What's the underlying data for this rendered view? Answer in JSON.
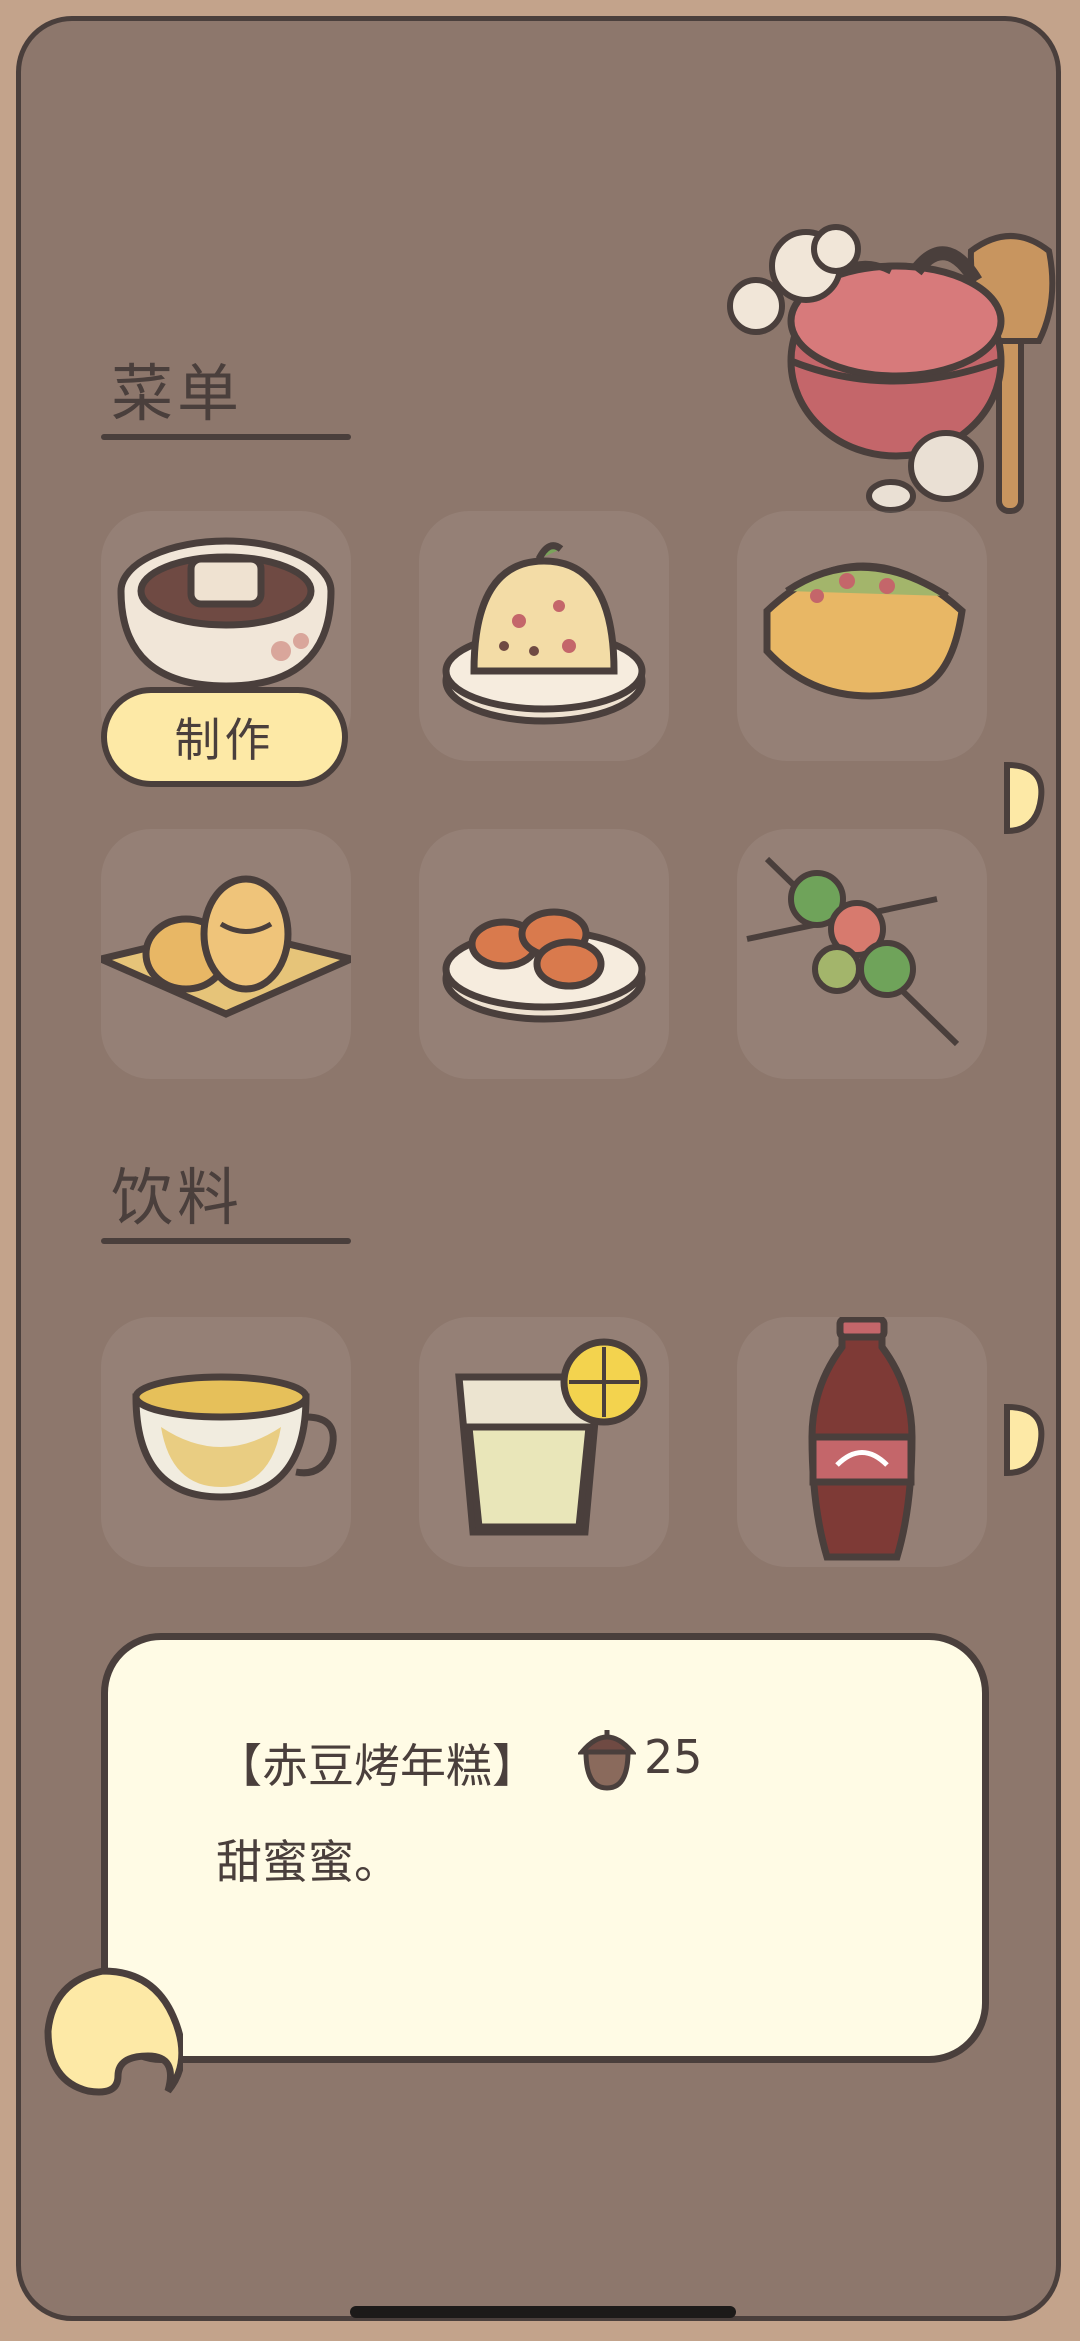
{
  "menu": {
    "food_title": "菜单",
    "drink_title": "饮料",
    "make_label": "制作",
    "food_items": [
      {
        "icon": "red-bean-cake-icon"
      },
      {
        "icon": "fried-rice-icon"
      },
      {
        "icon": "taco-icon"
      },
      {
        "icon": "taiyaki-icon"
      },
      {
        "icon": "dumplings-icon"
      },
      {
        "icon": "skewers-icon"
      }
    ],
    "drink_items": [
      {
        "icon": "tea-cup-icon"
      },
      {
        "icon": "lemonade-icon"
      },
      {
        "icon": "cola-bottle-icon"
      }
    ]
  },
  "detail": {
    "name": "【赤豆烤年糕】",
    "price": "25",
    "price_icon": "acorn-icon",
    "description": "甜蜜蜜。"
  },
  "colors": {
    "panel": "#8d776c",
    "outline": "#4a3f3c",
    "button": "#fde9a6",
    "info_box": "#fffbe5"
  }
}
